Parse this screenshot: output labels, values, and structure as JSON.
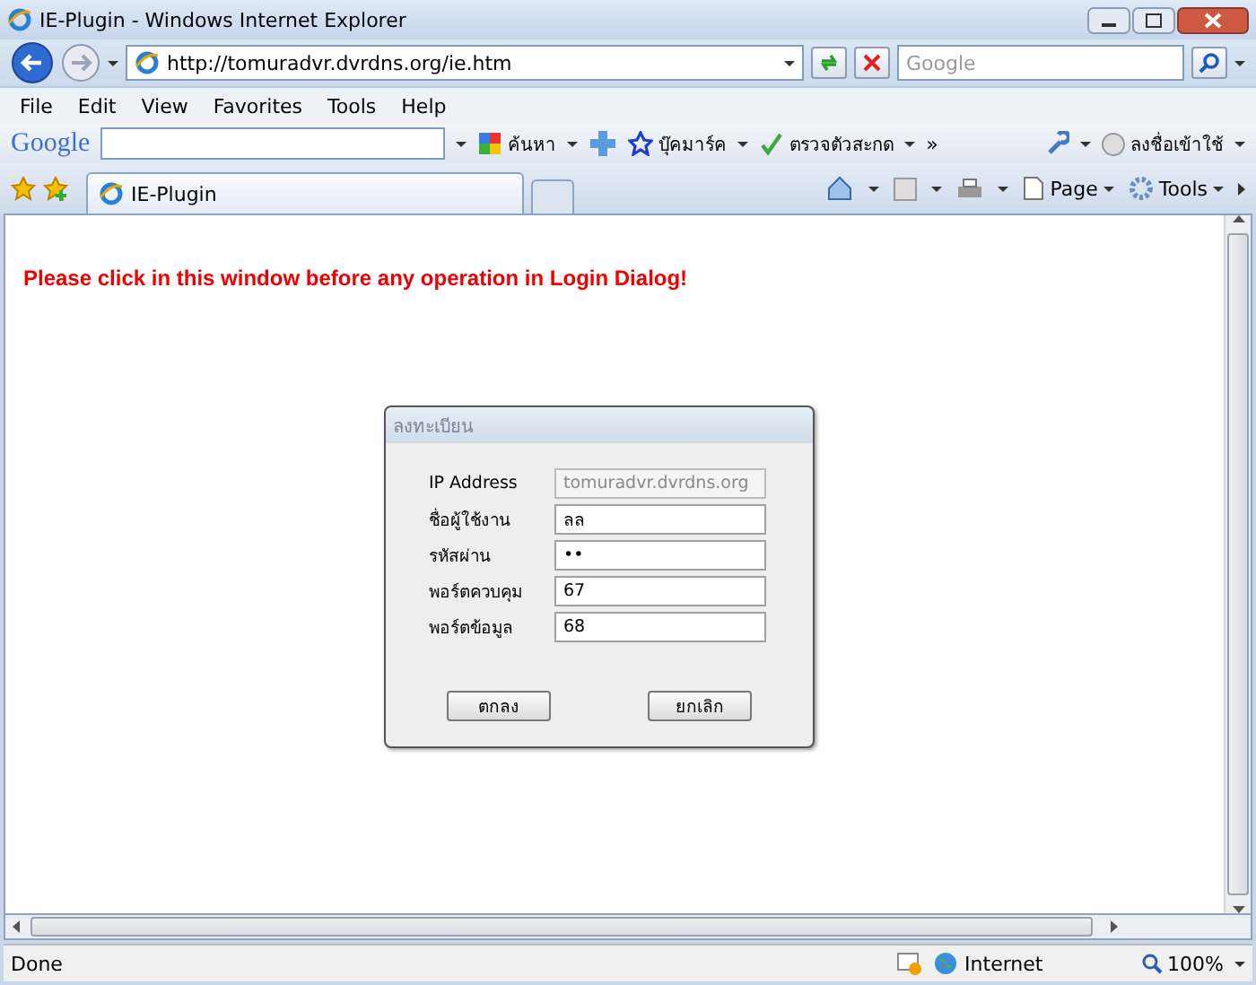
{
  "window": {
    "title": "IE-Plugin - Windows Internet Explorer"
  },
  "address": {
    "url": "http://tomuradvr.dvrdns.org/ie.htm"
  },
  "search": {
    "placeholder": "Google"
  },
  "menu": [
    "File",
    "Edit",
    "View",
    "Favorites",
    "Tools",
    "Help"
  ],
  "google_toolbar": {
    "logo": "Google",
    "items": [
      {
        "kind": "search",
        "label": "ค้นหา"
      },
      {
        "kind": "bookmark",
        "label": "บุ๊คมาร์ค"
      },
      {
        "kind": "spell",
        "label": "ตรวจตัวสะกด"
      }
    ],
    "more": "»",
    "sign_in": "ลงชื่อเข้าใช้"
  },
  "tabs": [
    {
      "label": "IE-Plugin",
      "selected": true
    }
  ],
  "command_bar": [
    "Page",
    "Tools"
  ],
  "page": {
    "message": "Please click in this window before any operation in Login Dialog!"
  },
  "dialog": {
    "title": "ลงทะเบียน",
    "fields": [
      {
        "label": "IP Address",
        "value": "tomuradvr.dvrdns.org",
        "disabled": true
      },
      {
        "label": "ชื่อผู้ใช้งาน",
        "value": "ลล",
        "disabled": false
      },
      {
        "label": "รหัสผ่าน",
        "value": "••",
        "disabled": false
      },
      {
        "label": "พอร์ตควบคุม",
        "value": "67",
        "disabled": false
      },
      {
        "label": "พอร์ตข้อมูล",
        "value": "68",
        "disabled": false
      }
    ],
    "buttons": [
      "ตกลง",
      "ยกเลิก"
    ]
  },
  "status_bar": {
    "text": "Done",
    "zone": "Internet",
    "zoom": "100%"
  }
}
